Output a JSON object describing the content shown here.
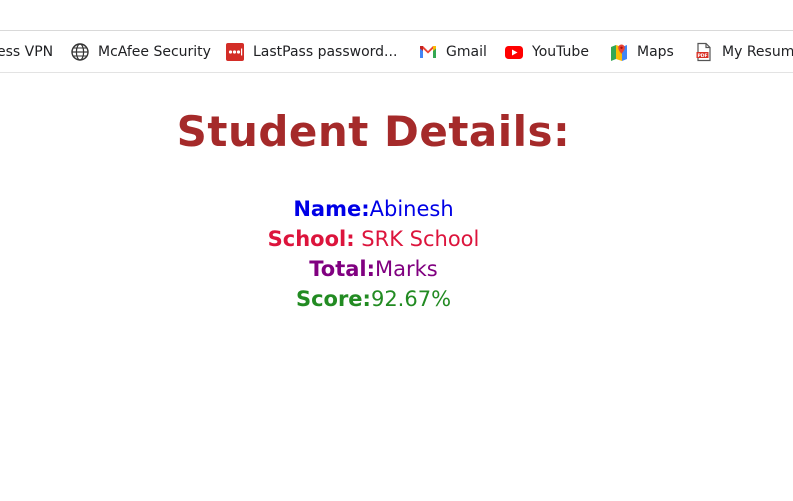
{
  "bookmarks": {
    "items": [
      {
        "label": "ess VPN",
        "icon": "vpn-icon"
      },
      {
        "label": "McAfee Security",
        "icon": "globe-icon"
      },
      {
        "label": "LastPass password...",
        "icon": "lastpass-icon"
      },
      {
        "label": "Gmail",
        "icon": "gmail-icon"
      },
      {
        "label": "YouTube",
        "icon": "youtube-icon"
      },
      {
        "label": "Maps",
        "icon": "maps-icon"
      },
      {
        "label": "My Resume",
        "icon": "pdf-icon"
      }
    ]
  },
  "page": {
    "title": "Student Details:",
    "fields": {
      "name": {
        "label": "Name:",
        "value": "Abinesh",
        "color": "#0000e6"
      },
      "school": {
        "label": "School:",
        "value": " SRK School",
        "color": "#dc143c"
      },
      "total": {
        "label": "Total:",
        "value": "Marks",
        "color": "#800080"
      },
      "score": {
        "label": "Score:",
        "value": "92.67%",
        "color": "#228b22"
      }
    },
    "title_color": "#a52a2a"
  }
}
